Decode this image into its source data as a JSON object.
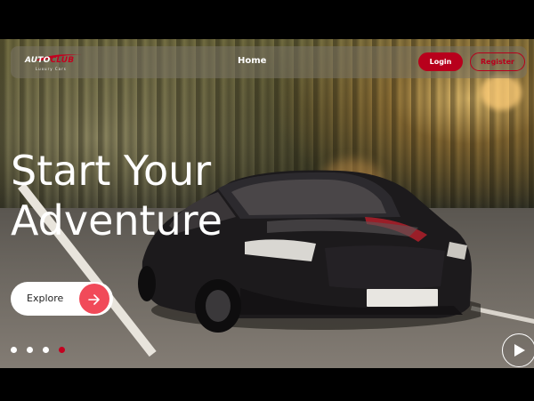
{
  "brand": {
    "logo_main_prefix": "AUTO",
    "logo_main_accent": "CLUB",
    "logo_sub": "Luxury Cars",
    "accent_color": "#c4001f"
  },
  "nav": {
    "home_label": "Home",
    "login_label": "Login",
    "register_label": "Register"
  },
  "hero": {
    "headline_line1": "Start Your",
    "headline_line2": "Adventure",
    "explore_label": "Explore",
    "explore_icon": "arrow-right-icon",
    "play_icon": "play-icon"
  },
  "carousel": {
    "slides": 4,
    "active_index": 3
  }
}
